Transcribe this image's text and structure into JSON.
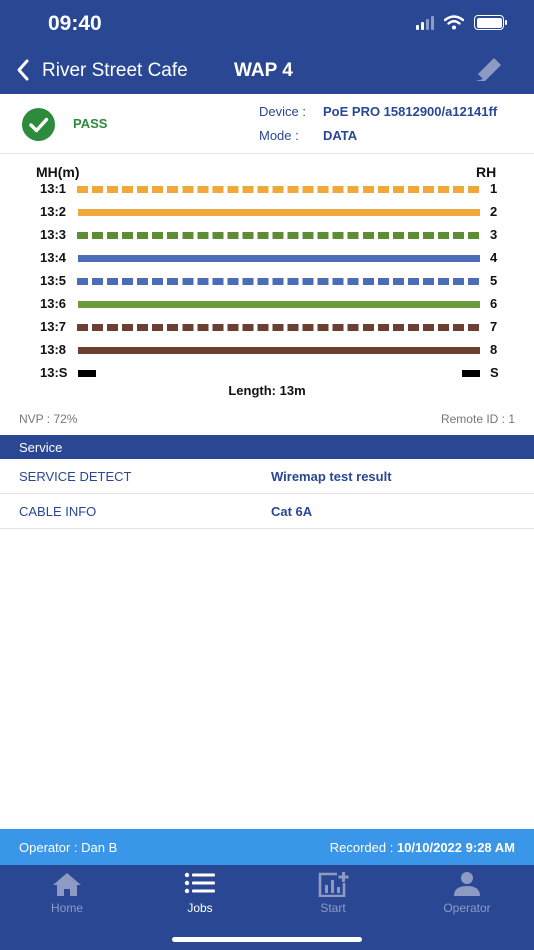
{
  "status_bar": {
    "time": "09:40"
  },
  "nav": {
    "site": "River Street Cafe",
    "title": "WAP 4"
  },
  "result": {
    "status": "PASS",
    "device_label": "Device :",
    "device_value": "PoE PRO 15812900/a12141ff",
    "mode_label": "Mode :",
    "mode_value": "DATA"
  },
  "wiremap": {
    "left_header": "MH(m)",
    "right_header": "RH",
    "rows": [
      {
        "label": "13:1",
        "pin": "1",
        "color": "#eea93a",
        "pattern": "dashed"
      },
      {
        "label": "13:2",
        "pin": "2",
        "color": "#eea93a",
        "pattern": "solid"
      },
      {
        "label": "13:3",
        "pin": "3",
        "color": "#5d8c34",
        "pattern": "dashed"
      },
      {
        "label": "13:4",
        "pin": "4",
        "color": "#4b6db8",
        "pattern": "solid"
      },
      {
        "label": "13:5",
        "pin": "5",
        "color": "#4b6db8",
        "pattern": "dashed"
      },
      {
        "label": "13:6",
        "pin": "6",
        "color": "#6b9a3a",
        "pattern": "solid"
      },
      {
        "label": "13:7",
        "pin": "7",
        "color": "#6b4030",
        "pattern": "dashed"
      },
      {
        "label": "13:8",
        "pin": "8",
        "color": "#6b4030",
        "pattern": "solid"
      },
      {
        "label": "13:S",
        "pin": "S",
        "color": "#000000",
        "pattern": "shield"
      }
    ],
    "length": "Length: 13m",
    "nvp": "NVP : 72%",
    "remote_id": "Remote ID : 1"
  },
  "service": {
    "header": "Service",
    "rows": [
      {
        "key": "SERVICE DETECT",
        "value": "Wiremap test result"
      },
      {
        "key": "CABLE INFO",
        "value": "Cat 6A"
      }
    ]
  },
  "footer": {
    "operator": "Operator : Dan B",
    "recorded_label": "Recorded :",
    "recorded_value": "10/10/2022 9:28 AM"
  },
  "tabs": [
    {
      "label": "Home",
      "icon": "home-icon",
      "active": false
    },
    {
      "label": "Jobs",
      "icon": "list-icon",
      "active": true
    },
    {
      "label": "Start",
      "icon": "chart-add-icon",
      "active": false
    },
    {
      "label": "Operator",
      "icon": "person-icon",
      "active": false
    }
  ]
}
